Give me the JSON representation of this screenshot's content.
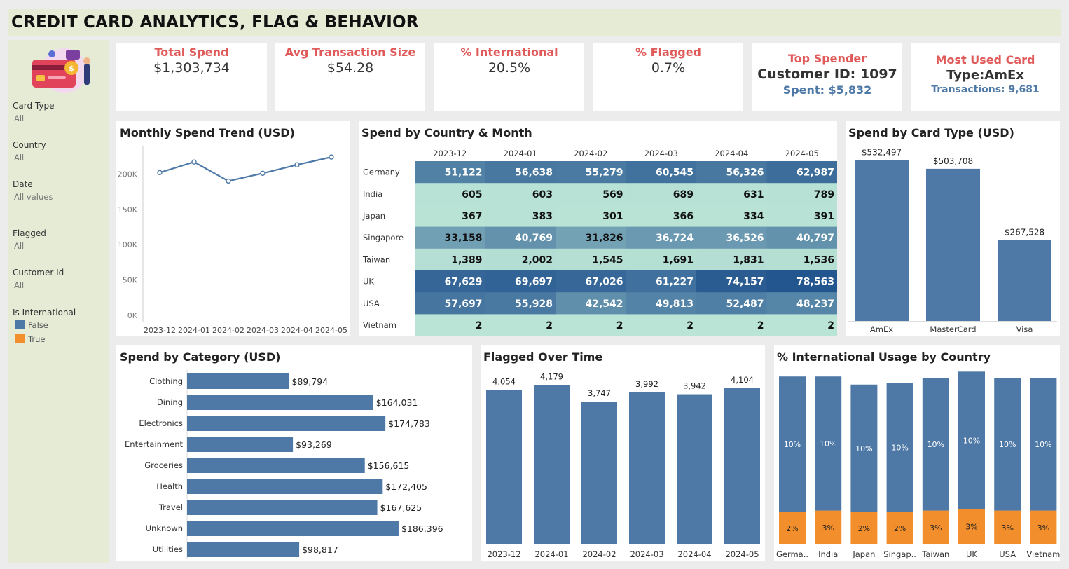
{
  "title": "CREDIT CARD ANALYTICS, FLAG & BEHAVIOR",
  "filters": [
    {
      "label": "Card Type",
      "value": "All"
    },
    {
      "label": "Country",
      "value": "All"
    },
    {
      "label": "Date",
      "value": "All values"
    },
    {
      "label": "Flagged",
      "value": "All"
    },
    {
      "label": "Customer Id",
      "value": "All"
    }
  ],
  "legend": {
    "title": "Is International",
    "items": [
      {
        "label": "False",
        "color": "#4e79a7"
      },
      {
        "label": "True",
        "color": "#f28e2b"
      }
    ]
  },
  "kpis": {
    "total_spend": {
      "title": "Total Spend",
      "value": "$1,303,734"
    },
    "avg_txn": {
      "title": "Avg Transaction Size",
      "value": "$54.28"
    },
    "pct_intl": {
      "title": "% International",
      "value": "20.5%"
    },
    "pct_flagged": {
      "title": "% Flagged",
      "value": "0.7%"
    },
    "top_spender": {
      "title": "Top Spender",
      "value": "Customer ID:  1097",
      "sub": "Spent: $5,832"
    },
    "most_used": {
      "title": "Most Used Card",
      "value": "Type:AmEx",
      "sub": "Transactions: 9,681"
    }
  },
  "panels": {
    "monthly": "Monthly Spend Trend (USD)",
    "heatmap": "Spend by Country & Month",
    "cardtype": "Spend by Card Type (USD)",
    "category": "Spend by Category (USD)",
    "flagged": "Flagged Over Time",
    "intl": "% International Usage by Country"
  },
  "chart_data": [
    {
      "id": "monthly",
      "type": "line",
      "x": [
        "2023-12",
        "2024-01",
        "2024-02",
        "2024-03",
        "2024-04",
        "2024-05"
      ],
      "values": [
        212000,
        227000,
        200000,
        211000,
        223000,
        234000
      ],
      "yticks": [
        {
          "v": 0,
          "label": "0K"
        },
        {
          "v": 50000,
          "label": "50K"
        },
        {
          "v": 100000,
          "label": "100K"
        },
        {
          "v": 150000,
          "label": "150K"
        },
        {
          "v": 200000,
          "label": "200K"
        }
      ],
      "ylim": [
        0,
        250000
      ],
      "color": "#4e79a7"
    },
    {
      "id": "heatmap",
      "type": "heatmap",
      "columns": [
        "2023-12",
        "2024-01",
        "2024-02",
        "2024-03",
        "2024-04",
        "2024-05"
      ],
      "rows": [
        {
          "name": "Germany",
          "values": [
            51122,
            56638,
            55279,
            60545,
            56326,
            62987
          ],
          "labels": [
            "51,122",
            "56,638",
            "55,279",
            "60,545",
            "56,326",
            "62,987"
          ]
        },
        {
          "name": "India",
          "values": [
            605,
            603,
            569,
            689,
            631,
            789
          ],
          "labels": [
            "605",
            "603",
            "569",
            "689",
            "631",
            "789"
          ]
        },
        {
          "name": "Japan",
          "values": [
            367,
            383,
            301,
            366,
            334,
            391
          ],
          "labels": [
            "367",
            "383",
            "301",
            "366",
            "334",
            "391"
          ]
        },
        {
          "name": "Singapore",
          "values": [
            33158,
            40769,
            31826,
            36724,
            36526,
            40797
          ],
          "labels": [
            "33,158",
            "40,769",
            "31,826",
            "36,724",
            "36,526",
            "40,797"
          ]
        },
        {
          "name": "Taiwan",
          "values": [
            1389,
            2002,
            1545,
            1691,
            1831,
            1536
          ],
          "labels": [
            "1,389",
            "2,002",
            "1,545",
            "1,691",
            "1,831",
            "1,536"
          ]
        },
        {
          "name": "UK",
          "values": [
            67629,
            69697,
            67026,
            61227,
            74157,
            78563
          ],
          "labels": [
            "67,629",
            "69,697",
            "67,026",
            "61,227",
            "74,157",
            "78,563"
          ]
        },
        {
          "name": "USA",
          "values": [
            57697,
            55928,
            42542,
            49813,
            52487,
            48237
          ],
          "labels": [
            "57,697",
            "55,928",
            "42,542",
            "49,813",
            "52,487",
            "48,237"
          ]
        },
        {
          "name": "Vietnam",
          "values": [
            2,
            2,
            2,
            2,
            2,
            2
          ],
          "labels": [
            "2",
            "2",
            "2",
            "2",
            "2",
            "2"
          ]
        }
      ]
    },
    {
      "id": "cardtype",
      "type": "bar",
      "categories": [
        "AmEx",
        "MasterCard",
        "Visa"
      ],
      "values": [
        532497,
        503708,
        267528
      ],
      "labels": [
        "$532,497",
        "$503,708",
        "$267,528"
      ],
      "ylim": [
        0,
        580000
      ],
      "color": "#4e79a7"
    },
    {
      "id": "category",
      "type": "bar",
      "orientation": "horizontal",
      "categories": [
        "Clothing",
        "Dining",
        "Electronics",
        "Entertainment",
        "Groceries",
        "Health",
        "Travel",
        "Unknown",
        "Utilities"
      ],
      "values": [
        89794,
        164031,
        174783,
        93269,
        156615,
        172405,
        167625,
        186396,
        98817
      ],
      "labels": [
        "$89,794",
        "$164,031",
        "$174,783",
        "$93,269",
        "$156,615",
        "$172,405",
        "$167,625",
        "$186,396",
        "$98,817"
      ],
      "xlim": [
        0,
        200000
      ],
      "color": "#4e79a7"
    },
    {
      "id": "flagged",
      "type": "bar",
      "categories": [
        "2023-12",
        "2024-01",
        "2024-02",
        "2024-03",
        "2024-04",
        "2024-05"
      ],
      "values": [
        4054,
        4179,
        3747,
        3992,
        3942,
        4104
      ],
      "labels": [
        "4,054",
        "4,179",
        "3,747",
        "3,992",
        "3,942",
        "4,104"
      ],
      "ylim": [
        0,
        4580
      ],
      "color": "#4e79a7"
    },
    {
      "id": "intl",
      "type": "bar",
      "stacked": true,
      "categories": [
        "Germa..",
        "India",
        "Japan",
        "Singap..",
        "Taiwan",
        "UK",
        "USA",
        "Vietnam"
      ],
      "series": [
        {
          "name": "False",
          "color": "#4e79a7",
          "values": [
            8.4,
            8.3,
            7.9,
            8.0,
            8.2,
            8.5,
            8.2,
            8.2
          ],
          "labels": [
            "10%",
            "10%",
            "10%",
            "10%",
            "10%",
            "10%",
            "10%",
            "10%"
          ]
        },
        {
          "name": "True",
          "color": "#f28e2b",
          "values": [
            2.0,
            2.1,
            2.0,
            2.0,
            2.1,
            2.2,
            2.1,
            2.1
          ],
          "labels": [
            "2%",
            "3%",
            "2%",
            "2%",
            "3%",
            "3%",
            "3%",
            "3%"
          ]
        }
      ],
      "ylim": [
        0,
        10.8
      ]
    }
  ]
}
